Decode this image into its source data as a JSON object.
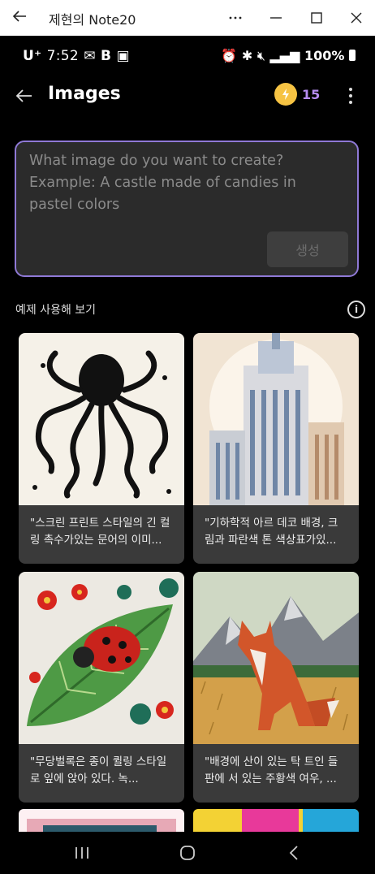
{
  "window": {
    "title": "제현의 Note20"
  },
  "status_bar": {
    "time": "7:52",
    "carrier": "U⁺",
    "battery": "100%"
  },
  "app_bar": {
    "title": "Images",
    "credits": "15"
  },
  "prompt": {
    "placeholder": "What image do you want to create?\nExample: A castle made of candies in pastel colors",
    "generate_label": "생성"
  },
  "examples": {
    "label": "예제 사용해 보기",
    "cards": [
      {
        "caption": "\"스크린 프린트 스타일의 긴 컬링 촉수가있는 문어의 이미..."
      },
      {
        "caption": "\"기하학적 아르 데코 배경, 크림과 파란색 톤 색상표가있..."
      },
      {
        "caption": "\"무당벌록은 종이 퀼링 스타일로 잎에 앉아 있다. 녹..."
      },
      {
        "caption": "\"배경에 산이 있는 탁 트인 들판에 서 있는 주황색 여우, ..."
      }
    ]
  },
  "icons": [
    "back-arrow-icon",
    "coin-icon",
    "more-vert-icon",
    "info-icon",
    "recents-icon",
    "home-icon",
    "nav-back-icon"
  ]
}
